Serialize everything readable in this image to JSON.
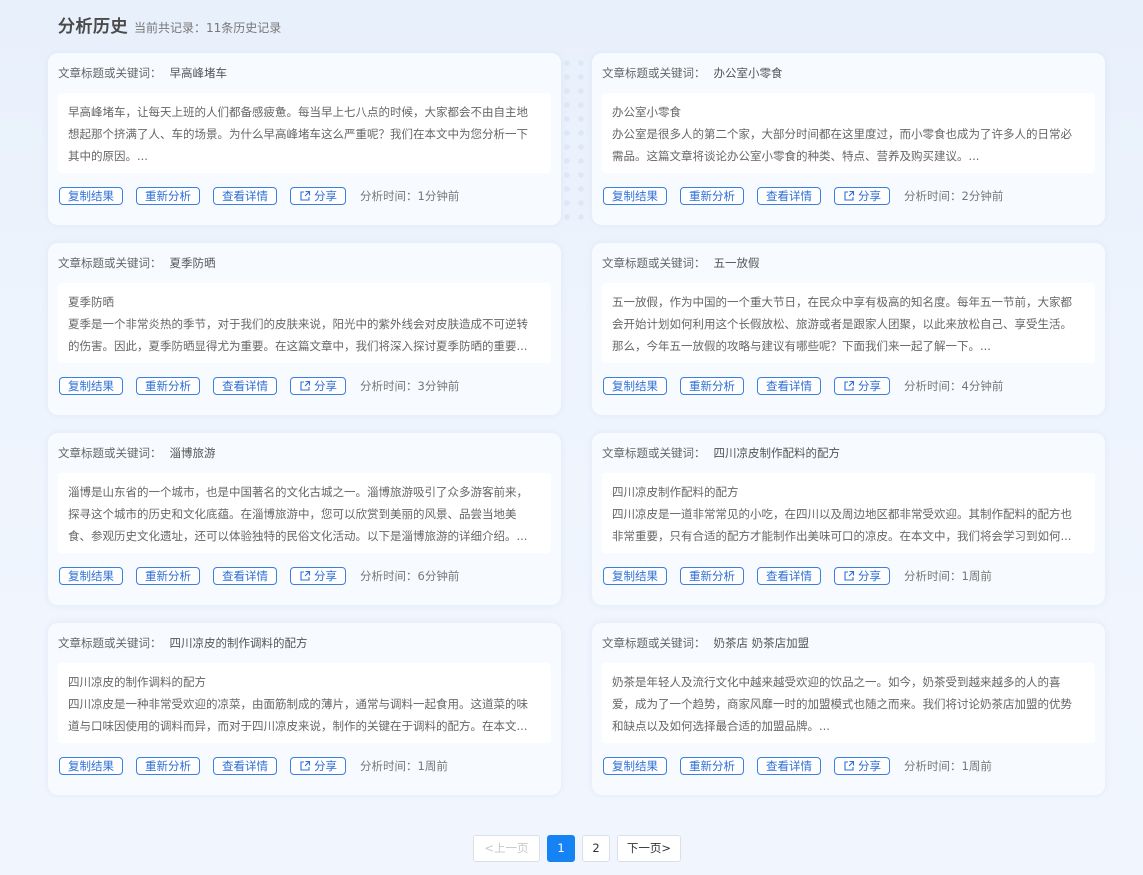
{
  "header": {
    "title": "分析历史",
    "subtitle": "当前共记录：11条历史记录"
  },
  "labels": {
    "keyword_label": "文章标题或关键词：",
    "copy": "复制结果",
    "reanalyze": "重新分析",
    "detail": "查看详情",
    "share": "分享",
    "time_label": "分析时间："
  },
  "cards": [
    {
      "keyword": "早高峰堵车",
      "lines": [
        "早高峰堵车，让每天上班的人们都备感疲惫。每当早上七八点的时候，大家都会不由自主地",
        "想起那个挤满了人、车的场景。为什么早高峰堵车这么严重呢？我们在本文中为您分析一下",
        "其中的原因。..."
      ],
      "time": "1分钟前"
    },
    {
      "keyword": "办公室小零食",
      "lines": [
        "办公室小零食",
        "办公室是很多人的第二个家，大部分时间都在这里度过，而小零食也成为了许多人的日常必",
        "需品。这篇文章将谈论办公室小零食的种类、特点、营养及购买建议。..."
      ],
      "time": "2分钟前"
    },
    {
      "keyword": "夏季防晒",
      "lines": [
        "夏季防晒",
        "夏季是一个非常炎热的季节，对于我们的皮肤来说，阳光中的紫外线会对皮肤造成不可逆转",
        "的伤害。因此，夏季防晒显得尤为重要。在这篇文章中，我们将深入探讨夏季防晒的重要..."
      ],
      "time": "3分钟前"
    },
    {
      "keyword": "五一放假",
      "lines": [
        "五一放假，作为中国的一个重大节日，在民众中享有极高的知名度。每年五一节前，大家都",
        "会开始计划如何利用这个长假放松、旅游或者是跟家人团聚，以此来放松自己、享受生活。",
        "那么，今年五一放假的攻略与建议有哪些呢？下面我们来一起了解一下。..."
      ],
      "time": "4分钟前"
    },
    {
      "keyword": "淄博旅游",
      "lines": [
        "淄博是山东省的一个城市，也是中国著名的文化古城之一。淄博旅游吸引了众多游客前来，",
        "探寻这个城市的历史和文化底蕴。在淄博旅游中，您可以欣赏到美丽的风景、品尝当地美",
        "食、参观历史文化遗址，还可以体验独特的民俗文化活动。以下是淄博旅游的详细介绍。..."
      ],
      "time": "6分钟前"
    },
    {
      "keyword": "四川凉皮制作配料的配方",
      "lines": [
        "四川凉皮制作配料的配方",
        "四川凉皮是一道非常常见的小吃，在四川以及周边地区都非常受欢迎。其制作配料的配方也",
        "非常重要，只有合适的配方才能制作出美味可口的凉皮。在本文中，我们将会学习到如何..."
      ],
      "time": "1周前"
    },
    {
      "keyword": "四川凉皮的制作调料的配方",
      "lines": [
        "四川凉皮的制作调料的配方",
        "四川凉皮是一种非常受欢迎的凉菜，由面筋制成的薄片，通常与调料一起食用。这道菜的味",
        "道与口味因使用的调料而异，而对于四川凉皮来说，制作的关键在于调料的配方。在本文..."
      ],
      "time": "1周前"
    },
    {
      "keyword": "奶茶店 奶茶店加盟",
      "lines": [
        "奶茶是年轻人及流行文化中越来越受欢迎的饮品之一。如今，奶茶受到越来越多的人的喜",
        "爱，成为了一个趋势，商家风靡一时的加盟模式也随之而来。我们将讨论奶茶店加盟的优势",
        "和缺点以及如何选择最合适的加盟品牌。..."
      ],
      "time": "1周前"
    }
  ],
  "pagination": {
    "prev": "<上一页",
    "pages": [
      "1",
      "2"
    ],
    "active_page": "1",
    "next": "下一页>"
  },
  "colors": {
    "accent": "#1683f5",
    "button_border": "#3a7ee6",
    "card_bg": "#f7fbff"
  }
}
